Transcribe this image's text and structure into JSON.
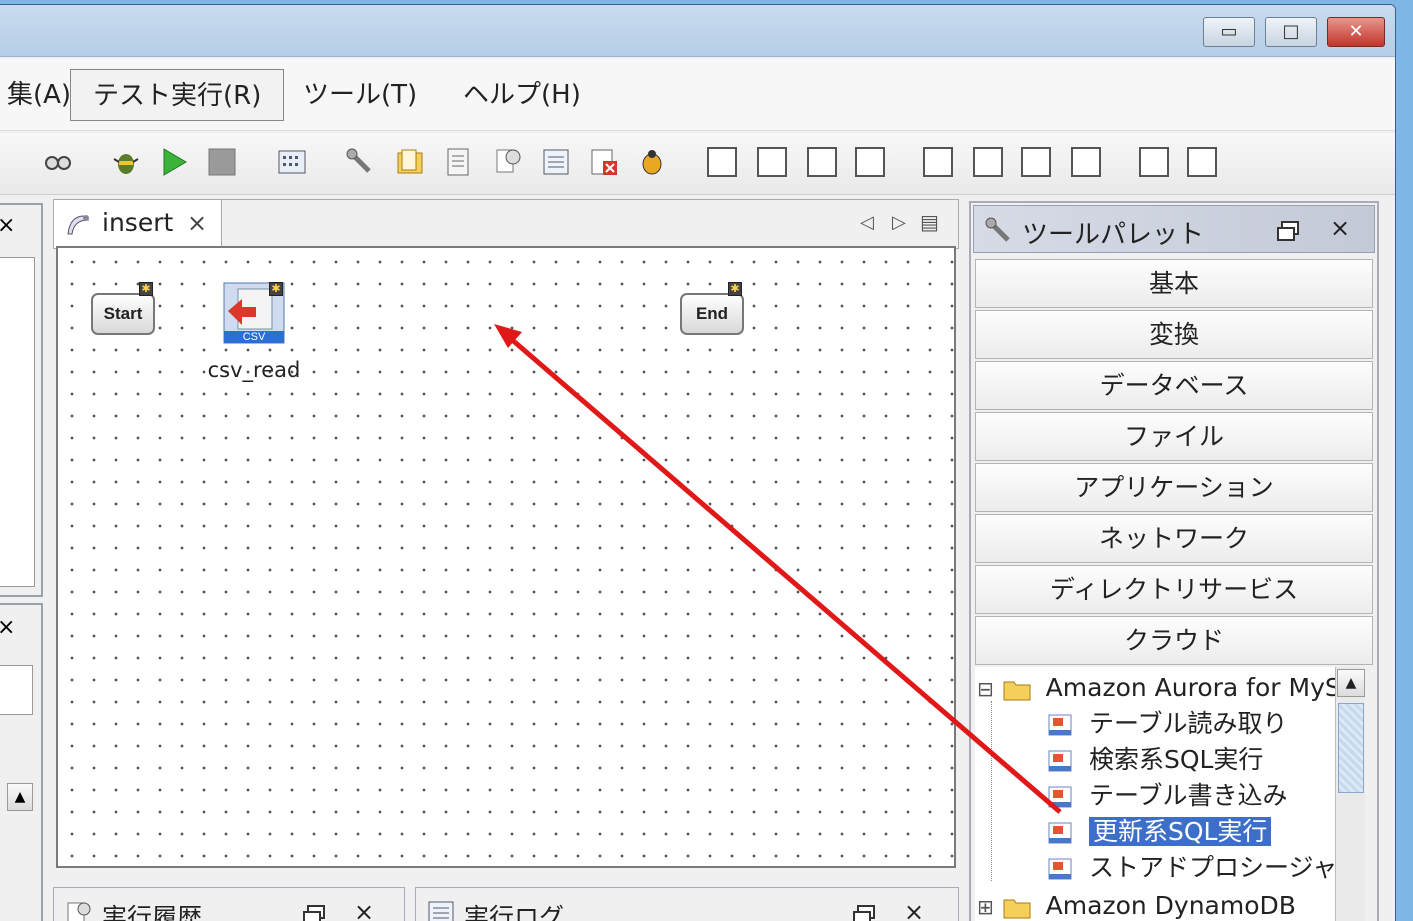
{
  "window": {
    "minimize_glyph": "▭",
    "maximize_glyph": "□",
    "close_glyph": "✕"
  },
  "menu": {
    "partial": "集(A)",
    "test_run": "テスト実行(R)",
    "tools": "ツール(T)",
    "help": "ヘルプ(H)"
  },
  "editor": {
    "tab_label": "insert",
    "tab_close": "×",
    "nav_left": "◁",
    "nav_right": "▷",
    "nav_list": "▤"
  },
  "canvas": {
    "start_label": "Start",
    "end_label": "End",
    "csv_icon_text": "CSV",
    "csv_node_label": "csv_read"
  },
  "palette": {
    "title": "ツールパレット",
    "close": "×",
    "categories": [
      "基本",
      "変換",
      "データベース",
      "ファイル",
      "アプリケーション",
      "ネットワーク",
      "ディレクトリサービス",
      "クラウド"
    ],
    "tree": {
      "group1": "Amazon Aurora for MySQL",
      "items": [
        "テーブル読み取り",
        "検索系SQL実行",
        "テーブル書き込み",
        "更新系SQL実行",
        "ストアドプロシージャ"
      ],
      "selected_index": 3,
      "group2": "Amazon DynamoDB",
      "expand_minus": "⊟",
      "expand_plus": "⊞"
    }
  },
  "bottom": {
    "history_title": "実行履歴",
    "log_title": "実行ログ",
    "close": "×"
  },
  "left": {
    "close": "×",
    "scroll_up": "▲"
  }
}
